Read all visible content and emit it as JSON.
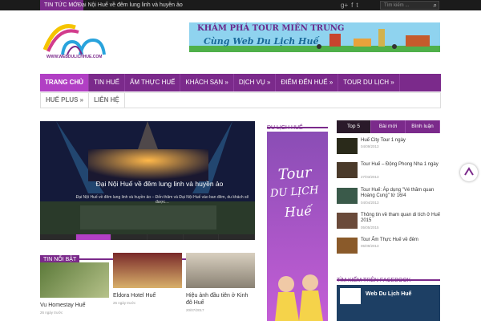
{
  "topbar": {
    "tag": "TIN TỨC MỚI",
    "ticker": "Đại Nội Huế về đêm lung linh và huyền ảo",
    "search_placeholder": "Tìm kiếm ..."
  },
  "logo": {
    "text": "WWW.WEBDULICHHUE.COM"
  },
  "banner": {
    "line1": "KHÁM PHÁ TOUR MIỀN TRUNG",
    "line2": "Cùng Web Du Lịch Huế"
  },
  "nav": {
    "items": [
      "TRANG CHỦ",
      "TIN HUẾ",
      "ẨM THỰC HUẾ",
      "KHÁCH SẠN »",
      "DỊCH VỤ »",
      "ĐIỂM ĐẾN HUẾ »",
      "TOUR DU LỊCH »"
    ],
    "items2": [
      "HUẾ PLUS »",
      "LIÊN HỆ"
    ]
  },
  "slider": {
    "caption": "Đại Nội Huế về đêm lung linh và huyền ảo",
    "desc": "Đại Nội Huế về đêm lung linh và huyền ảo – Đến thăm và Đại Nội Huế vào ban đêm, du khách sẽ được…"
  },
  "featured": {
    "title": "TIN NỔI BẬT",
    "items": [
      {
        "title": "Vu Homestay Huế",
        "date": "26 ngày trước"
      },
      {
        "title": "Eldora Hotel Huế",
        "date": "26 ngày trước"
      },
      {
        "title": "Hiệu ảnh đầu tiên ở Kinh đô Huế",
        "date": "20/07/2017"
      }
    ]
  },
  "mid": {
    "title": "DU LỊCH HUẾ",
    "ad_line1": "Tour",
    "ad_line2": "DU LỊCH",
    "ad_line3": "Huế"
  },
  "tabs": [
    "Top 5",
    "Bài mới",
    "Bình luận"
  ],
  "top5": [
    {
      "title": "Huế City Tour 1 ngày",
      "date": "04/09/2013"
    },
    {
      "title": "Tour Huế – Động Phong Nha 1 ngày",
      "date": "27/03/2013"
    },
    {
      "title": "Tour Huế: Áp dụng \"Vé thăm quan Hoàng Cung\" từ 16/4",
      "date": "04/04/2013"
    },
    {
      "title": "Thông tin về tham quan di tích ở Huế 2015",
      "date": "05/05/2015"
    },
    {
      "title": "Tour Ẩm Thực Huế về đêm",
      "date": "05/09/2013"
    }
  ],
  "facebook": {
    "title": "TÌM KIẾM TRÊN FACEBOOK",
    "page_name": "Web Du Lịch Huế"
  },
  "colors": {
    "accent": "#7b2a8b",
    "highlight": "#b13fc4"
  }
}
